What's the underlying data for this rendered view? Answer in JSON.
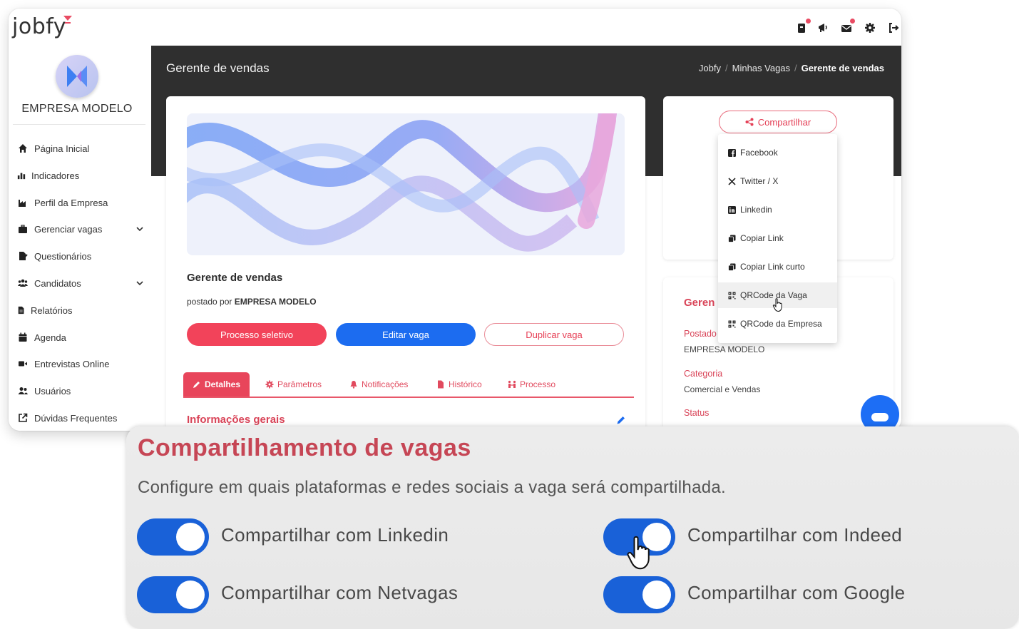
{
  "app": {
    "logo": "jobfy",
    "company_name": "EMPRESA MODELO"
  },
  "topbar_icons": [
    "briefcase-icon",
    "megaphone-icon",
    "mail-icon",
    "gear-icon",
    "logout-icon"
  ],
  "sidebar": {
    "items": [
      {
        "label": "Página Inicial",
        "icon": "home-icon"
      },
      {
        "label": "Indicadores",
        "icon": "chart-icon"
      },
      {
        "label": "Perfil da Empresa",
        "icon": "industry-icon"
      },
      {
        "label": "Gerenciar vagas",
        "icon": "briefcase-icon",
        "expandable": true
      },
      {
        "label": "Questionários",
        "icon": "file-signature-icon"
      },
      {
        "label": "Candidatos",
        "icon": "users-icon",
        "expandable": true
      },
      {
        "label": "Relatórios",
        "icon": "file-icon"
      },
      {
        "label": "Agenda",
        "icon": "calendar-icon"
      },
      {
        "label": "Entrevistas Online",
        "icon": "video-icon"
      },
      {
        "label": "Usuários",
        "icon": "user-group-icon"
      },
      {
        "label": "Dúvidas Frequentes",
        "icon": "external-link-icon"
      }
    ]
  },
  "header": {
    "title": "Gerente de vendas",
    "breadcrumb": [
      "Jobfy",
      "Minhas Vagas",
      "Gerente de vendas"
    ]
  },
  "job": {
    "title": "Gerente de vendas",
    "posted_prefix": "postado por",
    "posted_by": "EMPRESA MODELO",
    "buttons": {
      "processo": "Processo seletivo",
      "editar": "Editar vaga",
      "duplicar": "Duplicar vaga"
    },
    "tabs": [
      {
        "label": "Detalhes",
        "active": true
      },
      {
        "label": "Parâmetros"
      },
      {
        "label": "Notificações"
      },
      {
        "label": "Histórico"
      },
      {
        "label": "Processo"
      }
    ],
    "section_title": "Informações gerais"
  },
  "share": {
    "button_label": "Compartilhar",
    "menu": [
      {
        "label": "Facebook",
        "icon": "facebook-icon"
      },
      {
        "label": "Twitter / X",
        "icon": "x-icon"
      },
      {
        "label": "Linkedin",
        "icon": "linkedin-icon"
      },
      {
        "label": "Copiar Link",
        "icon": "copy-icon"
      },
      {
        "label": "Copiar Link curto",
        "icon": "copy-icon"
      },
      {
        "label": "QRCode da Vaga",
        "icon": "qrcode-icon",
        "hovered": true
      },
      {
        "label": "QRCode da Empresa",
        "icon": "qrcode-icon"
      }
    ]
  },
  "info": {
    "heading": "Geren",
    "posted_label": "Postado",
    "posted_value": "EMPRESA MODELO",
    "category_label": "Categoria",
    "category_value": "Comercial e Vendas",
    "status_label": "Status"
  },
  "settings": {
    "title": "Compartilhamento de vagas",
    "description": "Configure em quais plataformas e redes sociais a vaga será compartilhada.",
    "toggles": [
      {
        "label": "Compartilhar com Linkedin",
        "on": true
      },
      {
        "label": "Compartilhar com Indeed",
        "on": true
      },
      {
        "label": "Compartilhar com Netvagas",
        "on": true
      },
      {
        "label": "Compartilhar com Google",
        "on": true
      }
    ]
  },
  "colors": {
    "brand_red": "#e8455b",
    "brand_blue": "#1c6cf0",
    "dark_header": "#2f2f2f",
    "toggle_on": "#1961d8"
  }
}
